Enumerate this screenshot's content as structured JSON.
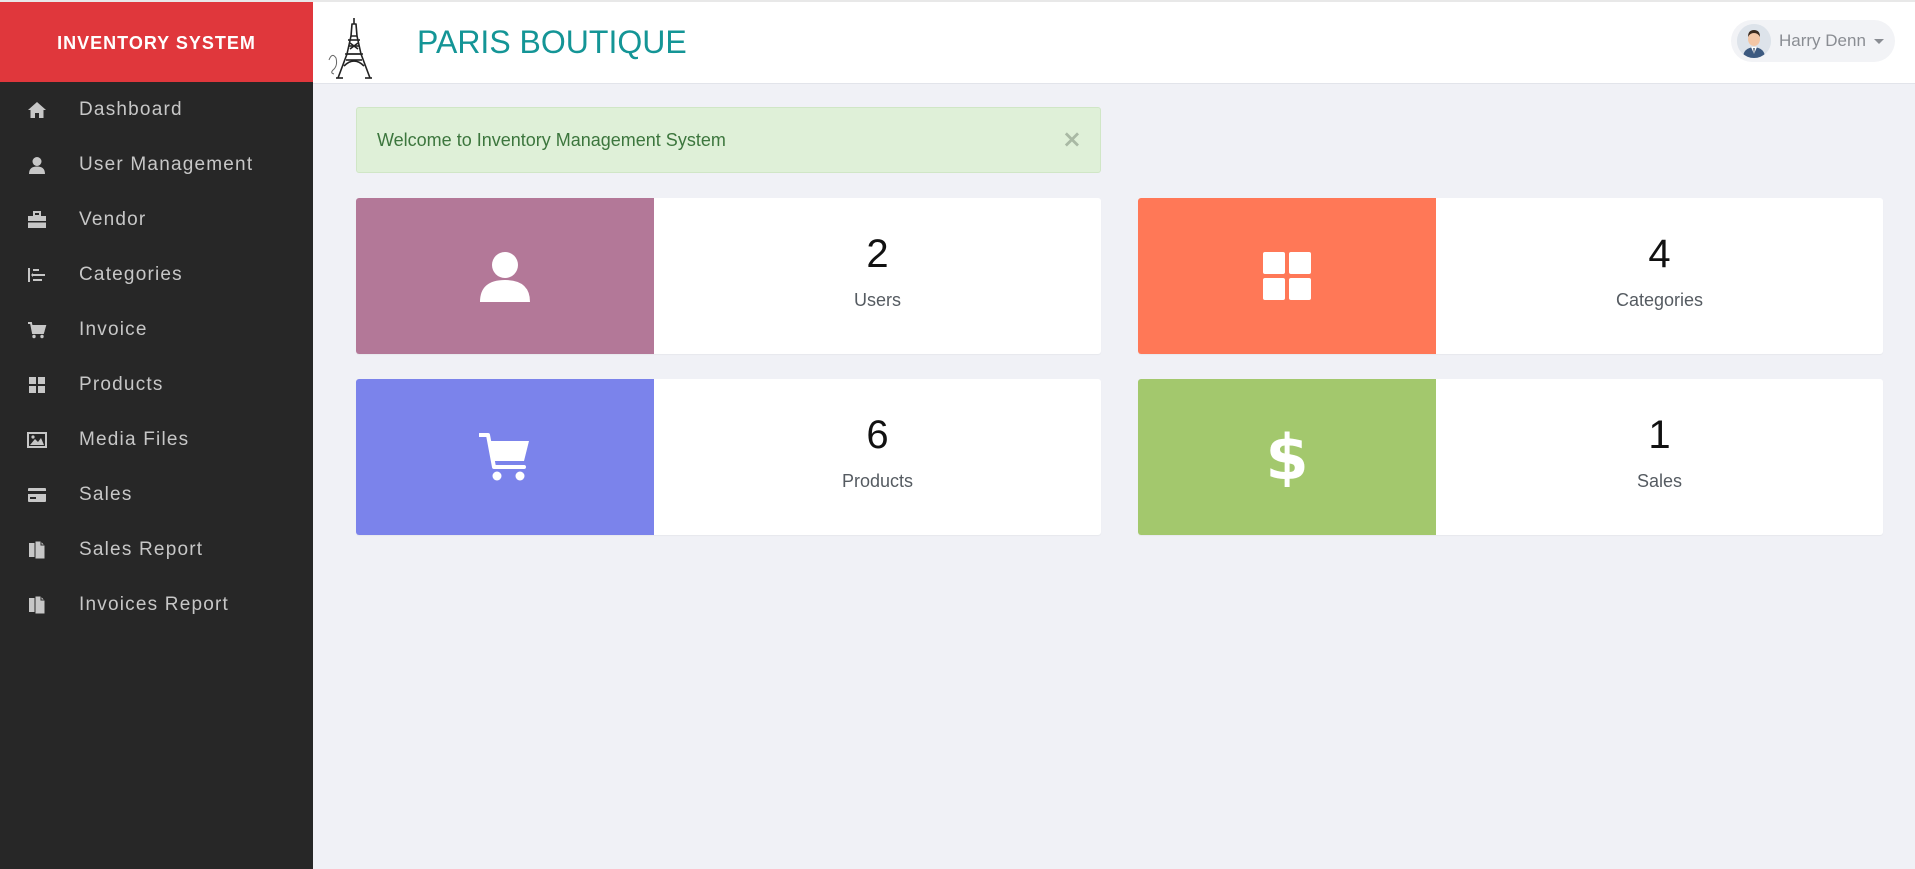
{
  "brand": {
    "title": "INVENTORY SYSTEM",
    "color": "#e0373c"
  },
  "header": {
    "shop_title": "PARIS BOUTIQUE",
    "logo_icon": "eiffel-tower-icon",
    "user_name": "Harry Denn"
  },
  "sidebar": {
    "items": [
      {
        "label": "Dashboard",
        "icon": "home-icon"
      },
      {
        "label": "User Management",
        "icon": "user-icon"
      },
      {
        "label": "Vendor",
        "icon": "briefcase-icon"
      },
      {
        "label": "Categories",
        "icon": "indent-icon"
      },
      {
        "label": "Invoice",
        "icon": "cart-icon"
      },
      {
        "label": "Products",
        "icon": "grid-icon"
      },
      {
        "label": "Media Files",
        "icon": "image-icon"
      },
      {
        "label": "Sales",
        "icon": "credit-card-icon"
      },
      {
        "label": "Sales Report",
        "icon": "copy-icon"
      },
      {
        "label": "Invoices Report",
        "icon": "copy-icon"
      }
    ]
  },
  "alert": {
    "message": "Welcome to Inventory Management System",
    "close_symbol": "×"
  },
  "stats": [
    {
      "value": "2",
      "label": "Users",
      "icon": "user-icon",
      "color": "#b37898"
    },
    {
      "value": "4",
      "label": "Categories",
      "icon": "grid-icon",
      "color": "#ff7857"
    },
    {
      "value": "6",
      "label": "Products",
      "icon": "cart-icon",
      "color": "#7b83eb"
    },
    {
      "value": "1",
      "label": "Sales",
      "icon": "dollar-icon",
      "color": "#a3c86d"
    }
  ]
}
